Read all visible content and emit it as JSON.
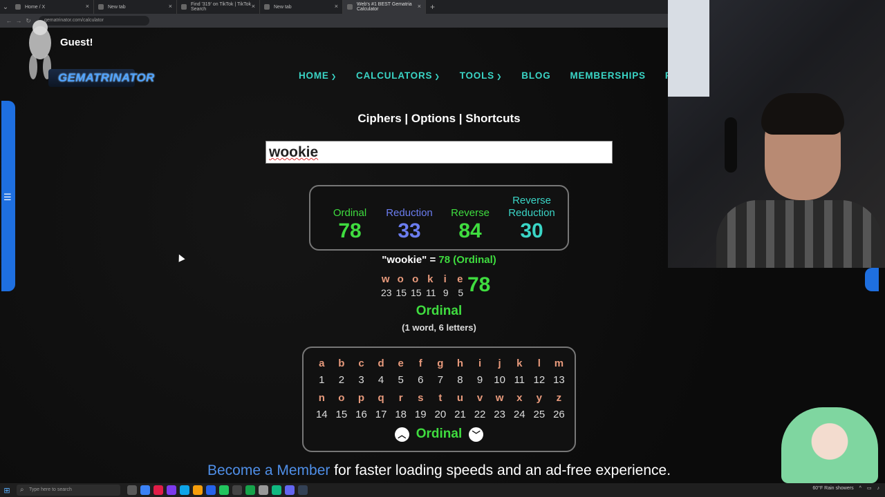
{
  "browser": {
    "tabs": [
      {
        "title": "Home / X"
      },
      {
        "title": "New tab"
      },
      {
        "title": "Find '319' on TikTok | TikTok Search"
      },
      {
        "title": "New tab"
      },
      {
        "title": "Web's #1 BEST Gematria Calculator"
      }
    ],
    "url": "gematrinator.com/calculator"
  },
  "site": {
    "greeting": "Guest!",
    "logo_text": "GEMATRINATOR",
    "nav": [
      "HOME",
      "CALCULATORS",
      "TOOLS",
      "BLOG",
      "MEMBERSHIPS",
      "FA"
    ],
    "heading": "Ciphers | Options | Shortcuts",
    "search_value": "wookie",
    "results": [
      {
        "label_line1": "",
        "label_line2": "Ordinal",
        "value": "78",
        "color": "#3fdc3f"
      },
      {
        "label_line1": "",
        "label_line2": "Reduction",
        "value": "33",
        "color": "#6b7df0"
      },
      {
        "label_line1": "",
        "label_line2": "Reverse",
        "value": "84",
        "color": "#3fdc3f"
      },
      {
        "label_line1": "Reverse",
        "label_line2": "Reduction",
        "value": "30",
        "color": "#3ad5c6"
      }
    ],
    "equation": {
      "word": "\"wookie\"",
      "equals": "=",
      "value": "78 (Ordinal)"
    },
    "breakdown": {
      "letters": [
        "w",
        "o",
        "o",
        "k",
        "i",
        "e"
      ],
      "values": [
        "23",
        "15",
        "15",
        "11",
        "9",
        "5"
      ],
      "total": "78"
    },
    "cipher_name": "Ordinal",
    "word_count": "(1 word, 6 letters)",
    "chart": {
      "row1_letters": [
        "a",
        "b",
        "c",
        "d",
        "e",
        "f",
        "g",
        "h",
        "i",
        "j",
        "k",
        "l",
        "m"
      ],
      "row1_values": [
        "1",
        "2",
        "3",
        "4",
        "5",
        "6",
        "7",
        "8",
        "9",
        "10",
        "11",
        "12",
        "13"
      ],
      "row2_letters": [
        "n",
        "o",
        "p",
        "q",
        "r",
        "s",
        "t",
        "u",
        "v",
        "w",
        "x",
        "y",
        "z"
      ],
      "row2_values": [
        "14",
        "15",
        "16",
        "17",
        "18",
        "19",
        "20",
        "21",
        "22",
        "23",
        "24",
        "25",
        "26"
      ],
      "cipher": "Ordinal"
    },
    "promo": {
      "link": "Become a Member",
      "rest": " for faster loading speeds and an ad-free experience."
    }
  },
  "taskbar": {
    "search_placeholder": "Type here to search",
    "weather": "60°F  Rain showers"
  }
}
